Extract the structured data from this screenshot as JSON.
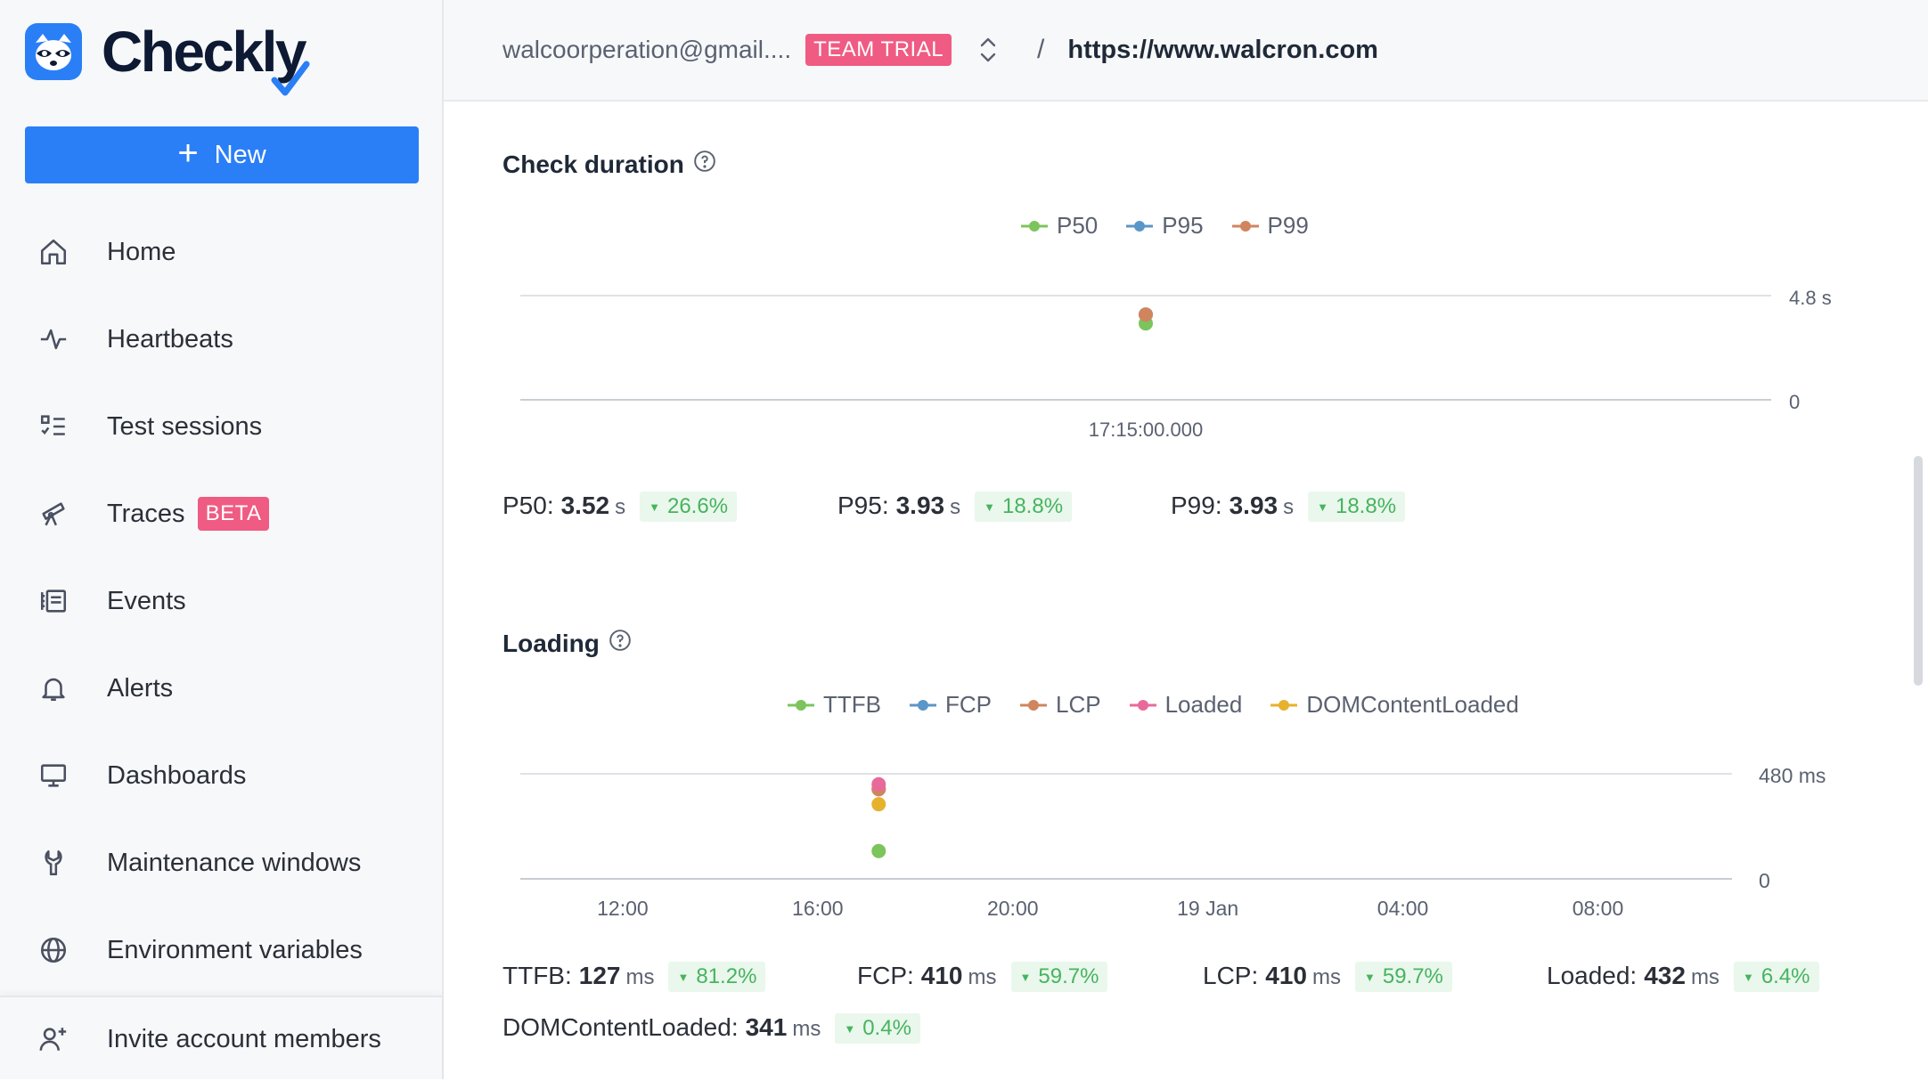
{
  "app": {
    "logo_text": "Checkly"
  },
  "sidebar": {
    "new_button_label": "New",
    "items": [
      {
        "label": "Home",
        "icon": "home-icon"
      },
      {
        "label": "Heartbeats",
        "icon": "heartbeat-icon"
      },
      {
        "label": "Test sessions",
        "icon": "checklist-icon"
      },
      {
        "label": "Traces",
        "icon": "telescope-icon",
        "badge": "BETA"
      },
      {
        "label": "Events",
        "icon": "events-list-icon"
      },
      {
        "label": "Alerts",
        "icon": "bell-icon"
      },
      {
        "label": "Dashboards",
        "icon": "monitor-icon"
      },
      {
        "label": "Maintenance windows",
        "icon": "wrench-icon"
      },
      {
        "label": "Environment variables",
        "icon": "globe-icon"
      }
    ],
    "footer_item": {
      "label": "Invite account members",
      "icon": "add-user-icon"
    }
  },
  "topbar": {
    "account": "walcoorperation@gmail....",
    "plan_badge": "TEAM TRIAL",
    "separator": "/",
    "url": "https://www.walcron.com"
  },
  "colors": {
    "accent": "#2a7ff6",
    "badge": "#ef5b82",
    "p50": "#7cc45c",
    "p95": "#5b96c8",
    "p99": "#d0855f",
    "ttfb": "#7cc45c",
    "fcp": "#5b96c8",
    "lcp": "#d0855f",
    "loaded": "#e86a9a",
    "domcontentloaded": "#e6b22e",
    "delta_good": "#46b45f"
  },
  "chart_data": [
    {
      "type": "scatter",
      "title": "Check duration",
      "legend": [
        "P50",
        "P95",
        "P99"
      ],
      "legend_position": "top-center",
      "y_unit": "s",
      "y_ticks": [
        "4.8 s",
        "0"
      ],
      "ylim": [
        0,
        4.8
      ],
      "x_ticks": [
        "17:15:00.000"
      ],
      "grid": true,
      "series": [
        {
          "name": "P50",
          "color": "#7cc45c",
          "points": [
            {
              "x": "17:15:00.000",
              "y": 3.52
            }
          ]
        },
        {
          "name": "P95",
          "color": "#5b96c8",
          "points": [
            {
              "x": "17:15:00.000",
              "y": 3.93
            }
          ]
        },
        {
          "name": "P99",
          "color": "#d0855f",
          "points": [
            {
              "x": "17:15:00.000",
              "y": 3.93
            }
          ]
        }
      ]
    },
    {
      "type": "scatter",
      "title": "Loading",
      "legend": [
        "TTFB",
        "FCP",
        "LCP",
        "Loaded",
        "DOMContentLoaded"
      ],
      "legend_position": "top-center",
      "y_unit": "ms",
      "y_ticks": [
        "480 ms",
        "0"
      ],
      "ylim": [
        0,
        480
      ],
      "x_ticks": [
        "12:00",
        "16:00",
        "20:00",
        "19 Jan",
        "04:00",
        "08:00"
      ],
      "xlim_hours": [
        9.9,
        34.75
      ],
      "grid": true,
      "series": [
        {
          "name": "TTFB",
          "color": "#7cc45c",
          "points": [
            {
              "x_hours": 17.25,
              "y": 127
            }
          ]
        },
        {
          "name": "FCP",
          "color": "#5b96c8",
          "points": [
            {
              "x_hours": 17.25,
              "y": 410
            }
          ]
        },
        {
          "name": "LCP",
          "color": "#d0855f",
          "points": [
            {
              "x_hours": 17.25,
              "y": 410
            }
          ]
        },
        {
          "name": "Loaded",
          "color": "#e86a9a",
          "points": [
            {
              "x_hours": 17.25,
              "y": 432
            }
          ]
        },
        {
          "name": "DOMContentLoaded",
          "color": "#e6b22e",
          "points": [
            {
              "x_hours": 17.25,
              "y": 341
            }
          ]
        }
      ]
    }
  ],
  "check_duration": {
    "title": "Check duration",
    "stats": [
      {
        "key": "P50:",
        "value": "3.52",
        "unit": "s",
        "delta": "26.6%"
      },
      {
        "key": "P95:",
        "value": "3.93",
        "unit": "s",
        "delta": "18.8%"
      },
      {
        "key": "P99:",
        "value": "3.93",
        "unit": "s",
        "delta": "18.8%"
      }
    ]
  },
  "loading": {
    "title": "Loading",
    "stats": [
      {
        "key": "TTFB:",
        "value": "127",
        "unit": "ms",
        "delta": "81.2%"
      },
      {
        "key": "FCP:",
        "value": "410",
        "unit": "ms",
        "delta": "59.7%"
      },
      {
        "key": "LCP:",
        "value": "410",
        "unit": "ms",
        "delta": "59.7%"
      },
      {
        "key": "Loaded:",
        "value": "432",
        "unit": "ms",
        "delta": "6.4%"
      },
      {
        "key": "DOMContentLoaded:",
        "value": "341",
        "unit": "ms",
        "delta": "0.4%"
      }
    ]
  }
}
